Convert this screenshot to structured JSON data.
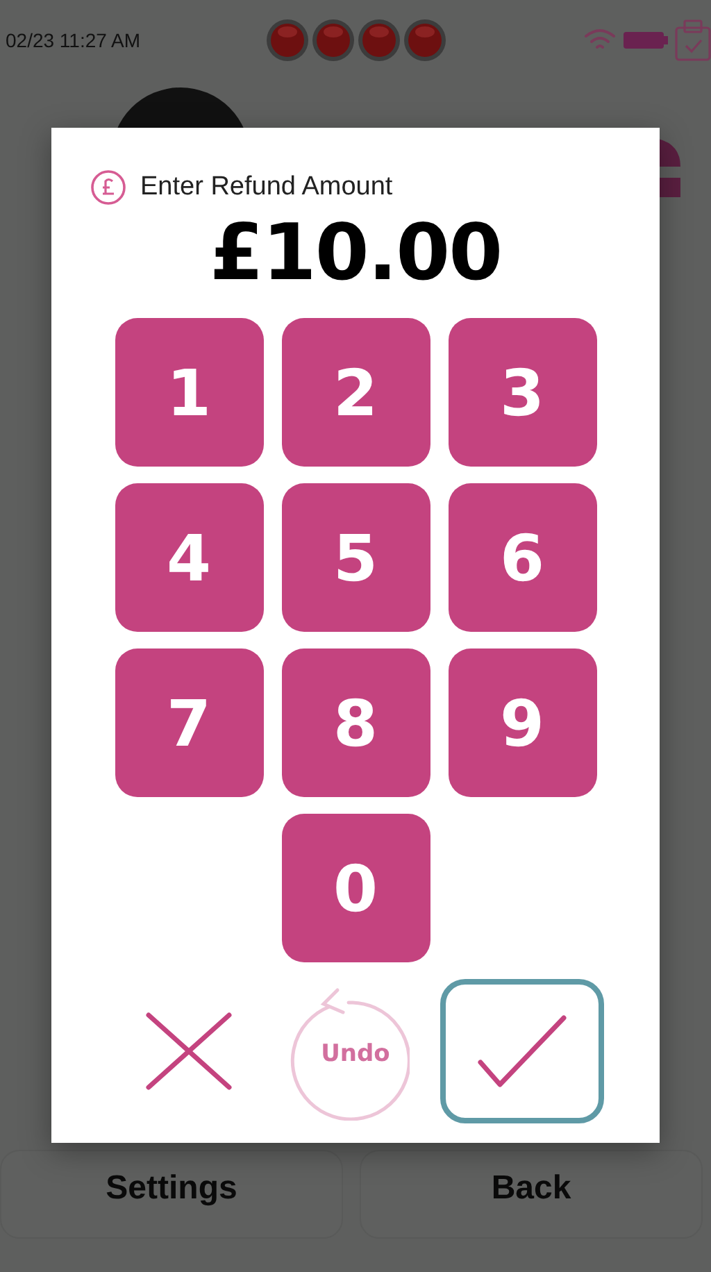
{
  "status_bar": {
    "time": "02/23 11:27 AM"
  },
  "background_buttons": [
    {
      "label": "Settings"
    },
    {
      "label": "Back"
    }
  ],
  "dialog": {
    "title": "Enter Refund Amount",
    "amount": "£10.00",
    "keys": [
      "1",
      "2",
      "3",
      "4",
      "5",
      "6",
      "7",
      "8",
      "9",
      "0"
    ],
    "actions": [
      {
        "kind": "cancel",
        "disabled": false,
        "focused": false
      },
      {
        "kind": "undo",
        "label": "Undo",
        "disabled": true,
        "focused": false
      },
      {
        "kind": "confirm",
        "disabled": false,
        "focused": true
      }
    ]
  }
}
